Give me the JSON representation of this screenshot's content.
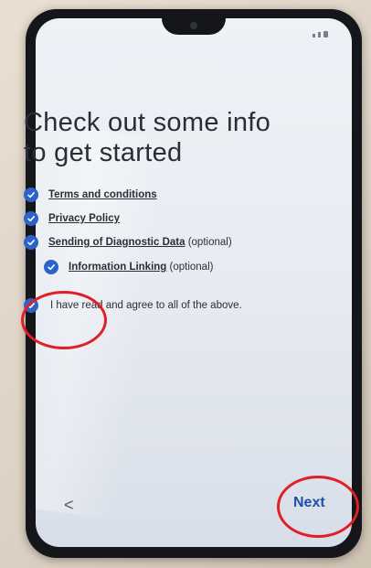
{
  "title": "Check out some info to get started",
  "items": [
    {
      "label": "Terms and conditions",
      "suffix": ""
    },
    {
      "label": "Privacy Policy",
      "suffix": ""
    },
    {
      "label": "Sending of Diagnostic Data",
      "suffix": " (optional)"
    },
    {
      "label": "Information Linking",
      "suffix": " (optional)"
    }
  ],
  "agree_label": "I have read and agree to all of the above.",
  "nav": {
    "back_label": "<",
    "next_label": "Next"
  },
  "colors": {
    "accent": "#2b63c9",
    "annotation": "#e01f26",
    "next_text": "#1f4fa8"
  },
  "icons": {
    "checkbox": "check-icon",
    "camera": "front-camera-icon"
  }
}
